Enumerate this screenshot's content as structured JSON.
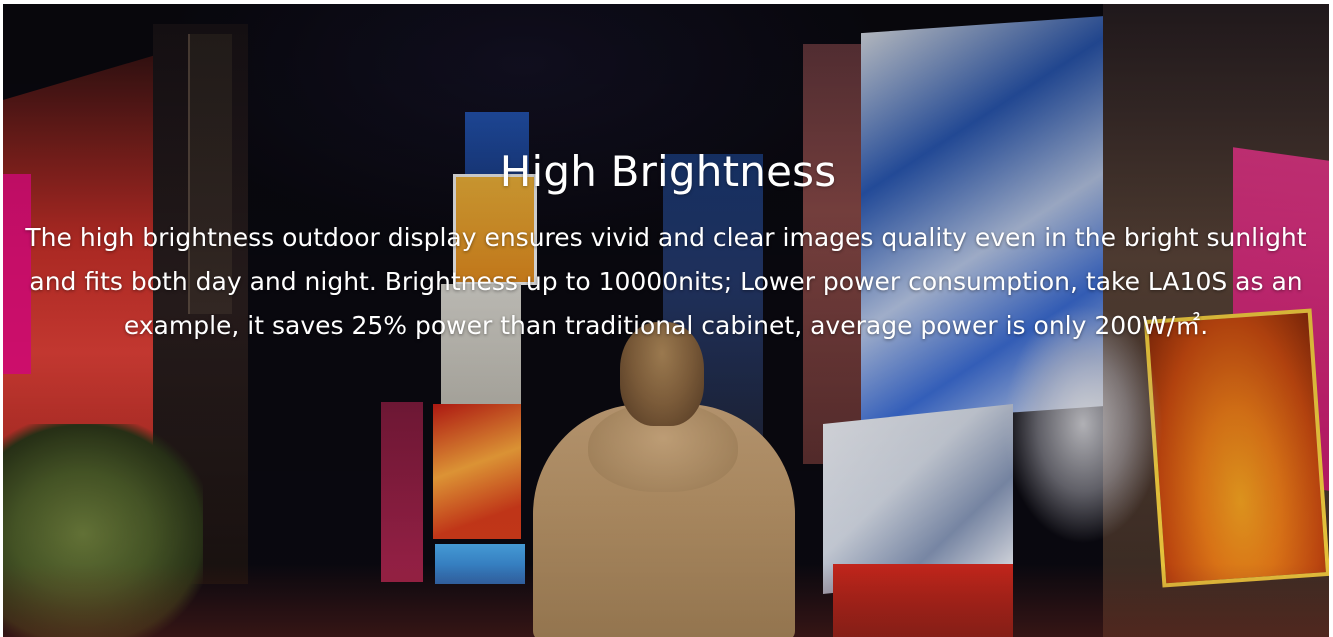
{
  "section": {
    "title": "High Brightness",
    "description": "The high brightness outdoor display ensures vivid and clear images quality even in the bright sunlight and fits both day and night. Brightness up to 10000nits; Lower power consumption, take LA10S as an example, it saves 25% power than traditional cabinet, average power is only 200W/㎡.",
    "text_color": "#ffffff",
    "background": "night-city-times-square-photo"
  }
}
